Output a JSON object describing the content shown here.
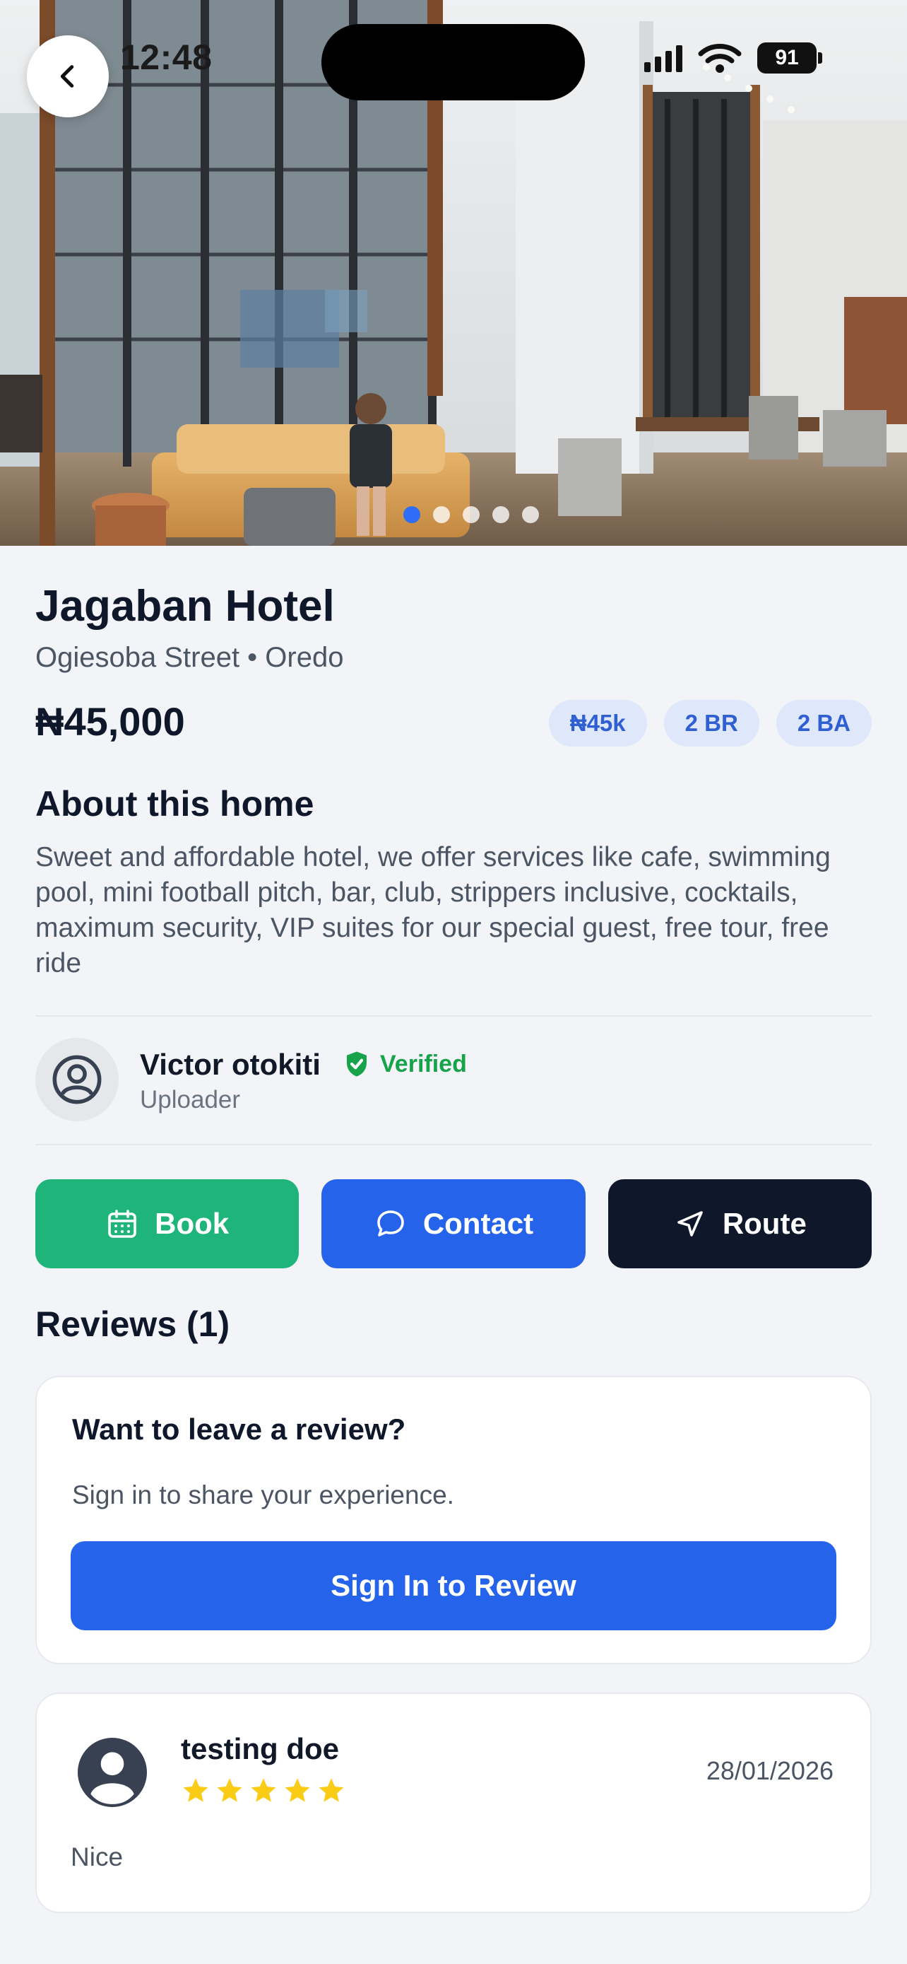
{
  "status_bar": {
    "time": "12:48",
    "battery": "91"
  },
  "hero": {
    "image_description_icon": "hotel-lobby-photo",
    "slide_count": 5,
    "active_slide": 1
  },
  "listing": {
    "name": "Jagaban Hotel",
    "location": "Ogiesoba Street • Oredo",
    "price": "₦45,000",
    "chips": [
      "₦45k",
      "2 BR",
      "2 BA"
    ]
  },
  "about": {
    "heading": "About this home",
    "text": "Sweet and affordable hotel, we offer services like cafe, swimming pool, mini football pitch, bar, club, strippers inclusive, cocktails, maximum security, VIP suites for our special guest, free tour, free ride"
  },
  "uploader": {
    "name": "Victor otokiti",
    "verified_label": "Verified",
    "role": "Uploader"
  },
  "actions": {
    "book_label": "Book",
    "contact_label": "Contact",
    "route_label": "Route"
  },
  "reviews": {
    "heading": "Reviews (1)",
    "prompt_title": "Want to leave a review?",
    "prompt_text": "Sign in to share your experience.",
    "signin_label": "Sign In to Review",
    "items": [
      {
        "name": "testing doe",
        "rating": 5,
        "date": "28/01/2026",
        "text": "Nice"
      }
    ]
  },
  "colors": {
    "primary_blue": "#2563eb",
    "book_green": "#1fb57a",
    "route_dark": "#0f172a",
    "verified_green": "#16a34a",
    "star_yellow": "#facc15",
    "chip_bg": "#dfe7fb"
  }
}
